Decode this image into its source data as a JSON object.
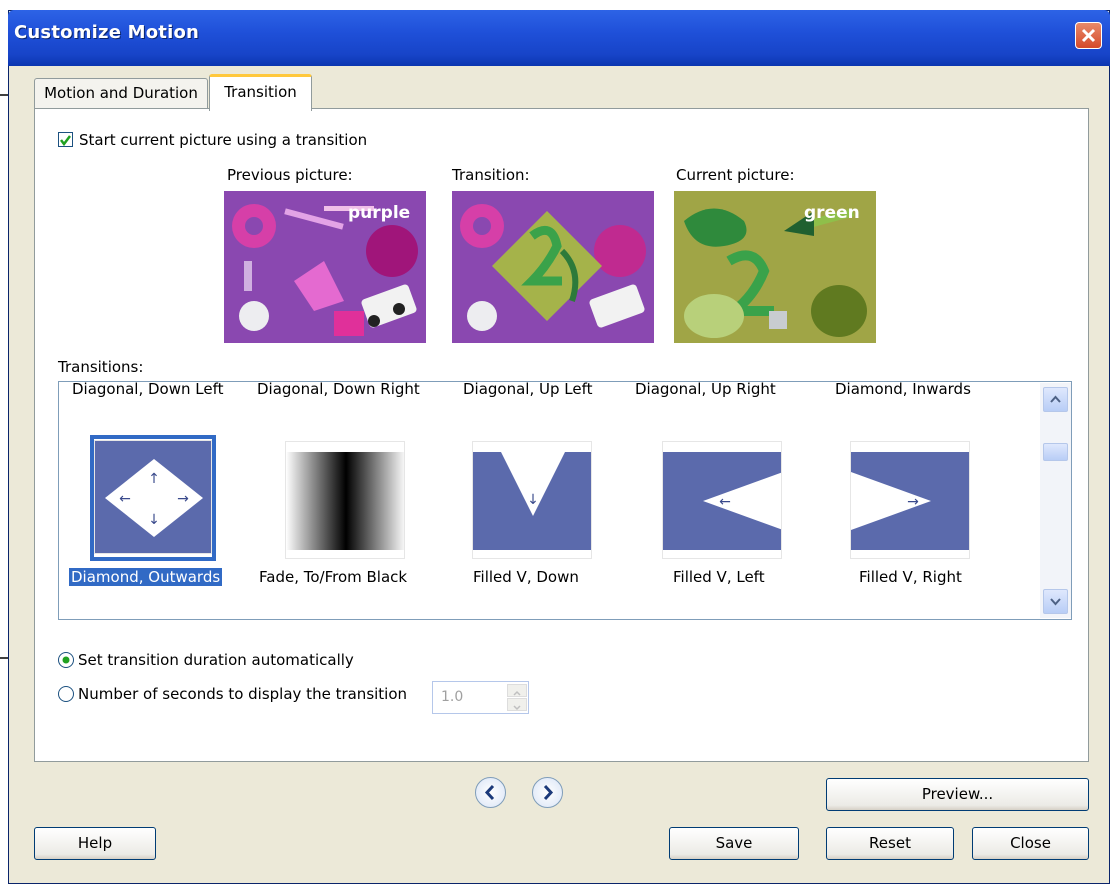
{
  "window": {
    "title": "Customize Motion"
  },
  "tabs": [
    {
      "label": "Motion and Duration"
    },
    {
      "label": "Transition"
    }
  ],
  "start_checkbox": {
    "label": "Start current picture using a transition",
    "checked": true
  },
  "previews": {
    "previous_label": "Previous picture:",
    "transition_label": "Transition:",
    "current_label": "Current picture:",
    "previous_text": "purple",
    "current_text": "green"
  },
  "transitions": {
    "label": "Transitions:",
    "top_row": [
      "Diagonal, Down Left",
      "Diagonal, Down Right",
      "Diagonal, Up Left",
      "Diagonal, Up Right",
      "Diamond, Inwards"
    ],
    "items": [
      {
        "label": "Diamond, Outwards",
        "selected": true
      },
      {
        "label": "Fade, To/From Black",
        "selected": false
      },
      {
        "label": "Filled V, Down",
        "selected": false
      },
      {
        "label": "Filled V, Left",
        "selected": false
      },
      {
        "label": "Filled V, Right",
        "selected": false
      }
    ]
  },
  "duration": {
    "auto_label": "Set transition duration automatically",
    "auto_selected": true,
    "manual_label": "Number of seconds to display the transition",
    "seconds_value": "1.0"
  },
  "buttons": {
    "preview": "Preview...",
    "help": "Help",
    "save": "Save",
    "reset": "Reset",
    "close": "Close"
  },
  "colors": {
    "titlebar": "#1f50d9",
    "selection": "#316ac5",
    "transition_blue": "#5b6aac"
  }
}
